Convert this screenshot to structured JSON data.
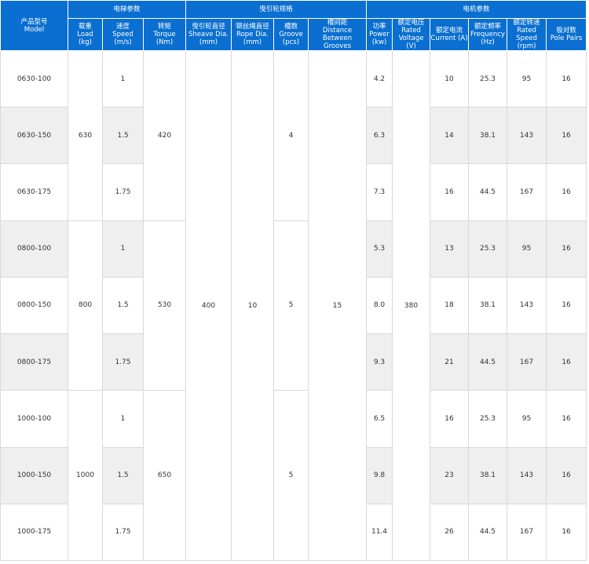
{
  "header": {
    "model": [
      "产品型号",
      "Model"
    ],
    "group_elevator": "电梯参数",
    "group_sheave": "曳引轮规格",
    "group_motor": "电机参数",
    "load": [
      "载重",
      "Load",
      "(kg)"
    ],
    "speed": [
      "速度",
      "Speed",
      "(m/s)"
    ],
    "torque": [
      "转矩",
      "Torque",
      "(Nm)"
    ],
    "sheave_dia": [
      "曳引轮直径",
      "Sheave Dia.",
      "(mm)"
    ],
    "rope_dia": [
      "钢丝绳直径",
      "Rope Dia.",
      "(mm)"
    ],
    "groove": [
      "槽数",
      "Groove",
      "(pcs)"
    ],
    "distance": [
      "槽间距",
      "Distance Between",
      "Grooves"
    ],
    "power": [
      "功率",
      "Power",
      "(kw)"
    ],
    "voltage": [
      "额定电压",
      "Rated",
      "Voltage (V)"
    ],
    "current": [
      "额定电流",
      "Current (A)"
    ],
    "frequency": [
      "额定频率",
      "Frequency",
      "(Hz)"
    ],
    "rated_speed": [
      "额定转速",
      "Rated Speed",
      "(rpm)"
    ],
    "pole_pairs": [
      "极对数",
      "Pole Pairs"
    ]
  },
  "groups": [
    {
      "load": "630",
      "torque": "420",
      "grooves": "4"
    },
    {
      "load": "800",
      "torque": "530",
      "grooves": "5"
    },
    {
      "load": "1000",
      "torque": "650",
      "grooves": "5"
    }
  ],
  "shared": {
    "sheave_dia": "400",
    "rope_dia": "10",
    "distance": "15",
    "voltage": "380"
  },
  "rows": [
    {
      "model": "0630-100",
      "speed": "1",
      "power": "4.2",
      "current": "10",
      "frequency": "25.3",
      "rated_speed": "95",
      "pole_pairs": "16"
    },
    {
      "model": "0630-150",
      "speed": "1.5",
      "power": "6.3",
      "current": "14",
      "frequency": "38.1",
      "rated_speed": "143",
      "pole_pairs": "16"
    },
    {
      "model": "0630-175",
      "speed": "1.75",
      "power": "7.3",
      "current": "16",
      "frequency": "44.5",
      "rated_speed": "167",
      "pole_pairs": "16"
    },
    {
      "model": "0800-100",
      "speed": "1",
      "power": "5.3",
      "current": "13",
      "frequency": "25.3",
      "rated_speed": "95",
      "pole_pairs": "16"
    },
    {
      "model": "0800-150",
      "speed": "1.5",
      "power": "8.0",
      "current": "18",
      "frequency": "38.1",
      "rated_speed": "143",
      "pole_pairs": "16"
    },
    {
      "model": "0800-175",
      "speed": "1.75",
      "power": "9.3",
      "current": "21",
      "frequency": "44.5",
      "rated_speed": "167",
      "pole_pairs": "16"
    },
    {
      "model": "1000-100",
      "speed": "1",
      "power": "6.5",
      "current": "16",
      "frequency": "25.3",
      "rated_speed": "95",
      "pole_pairs": "16"
    },
    {
      "model": "1000-150",
      "speed": "1.5",
      "power": "9.8",
      "current": "23",
      "frequency": "38.1",
      "rated_speed": "143",
      "pole_pairs": "16"
    },
    {
      "model": "1000-175",
      "speed": "1.75",
      "power": "11.4",
      "current": "26",
      "frequency": "44.5",
      "rated_speed": "167",
      "pole_pairs": "16"
    }
  ]
}
